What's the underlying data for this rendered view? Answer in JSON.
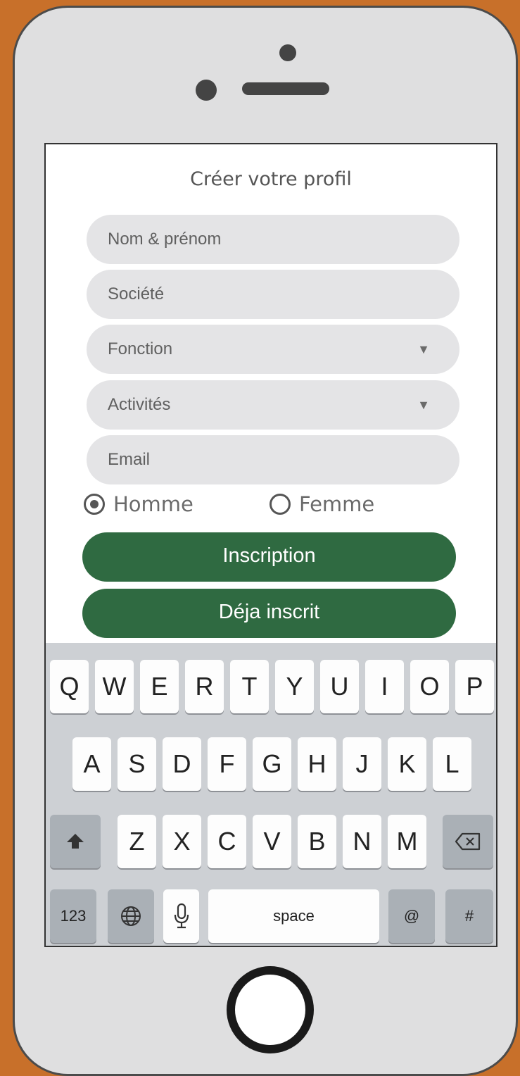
{
  "form": {
    "title": "Créer votre profil",
    "fields": [
      {
        "placeholder": "Nom & prénom"
      },
      {
        "placeholder": "Société"
      },
      {
        "placeholder": "Fonction",
        "dropdown": true
      },
      {
        "placeholder": "Activités",
        "dropdown": true
      },
      {
        "placeholder": "Email"
      }
    ],
    "dropdown_caret": "▼",
    "gender": {
      "options": [
        "Homme",
        "Femme"
      ],
      "selected": "Homme"
    },
    "buttons": {
      "register": "Inscription",
      "already": "Déja inscrit"
    }
  },
  "keyboard": {
    "row1": [
      "Q",
      "W",
      "E",
      "R",
      "T",
      "Y",
      "U",
      "I",
      "O",
      "P"
    ],
    "row2": [
      "A",
      "S",
      "D",
      "F",
      "G",
      "H",
      "J",
      "K",
      "L"
    ],
    "row3": [
      "Z",
      "X",
      "C",
      "V",
      "B",
      "N",
      "M"
    ],
    "shift_icon": "shift-arrow",
    "backspace_icon": "delete-key",
    "numbers": "123",
    "globe_icon": "globe",
    "mic_icon": "microphone",
    "space": "space",
    "at": "@",
    "hash": "#"
  },
  "colors": {
    "frame": "#c8702a",
    "accent": "#2f6a41"
  }
}
